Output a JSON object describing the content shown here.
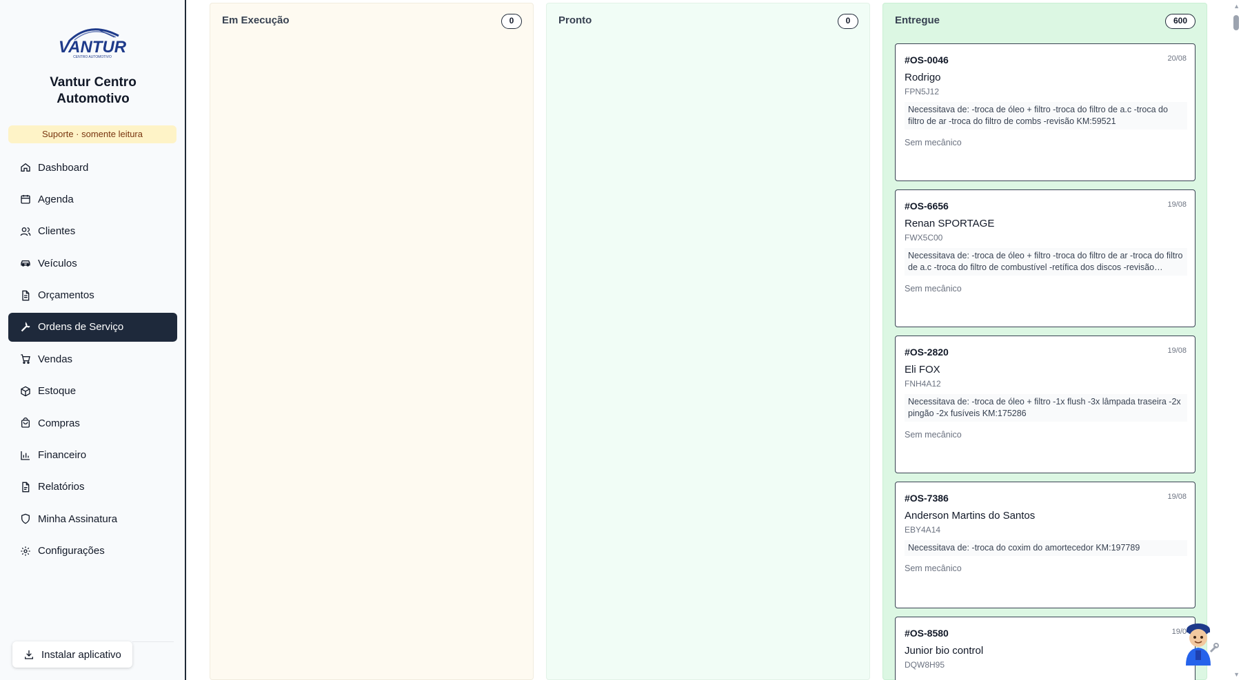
{
  "sidebar": {
    "company_name": "Vantur Centro Automotivo",
    "support_badge": "Suporte · somente leitura",
    "nav_items": [
      {
        "label": "Dashboard",
        "icon": "home-icon"
      },
      {
        "label": "Agenda",
        "icon": "calendar-icon"
      },
      {
        "label": "Clientes",
        "icon": "users-icon"
      },
      {
        "label": "Veículos",
        "icon": "car-icon"
      },
      {
        "label": "Orçamentos",
        "icon": "file-text-icon"
      },
      {
        "label": "Ordens de Serviço",
        "icon": "wrench-icon",
        "active": true
      },
      {
        "label": "Vendas",
        "icon": "cart-icon"
      },
      {
        "label": "Estoque",
        "icon": "package-icon"
      },
      {
        "label": "Compras",
        "icon": "shopping-bag-icon"
      },
      {
        "label": "Financeiro",
        "icon": "bar-chart-icon"
      },
      {
        "label": "Relatórios",
        "icon": "report-icon"
      },
      {
        "label": "Minha Assinatura",
        "icon": "shield-icon"
      },
      {
        "label": "Configurações",
        "icon": "gear-icon"
      }
    ],
    "install_label": "Instalar aplicativo"
  },
  "board": {
    "columns": [
      {
        "title": "Em Execução",
        "count": "0"
      },
      {
        "title": "Pronto",
        "count": "0"
      },
      {
        "title": "Entregue",
        "count": "600"
      }
    ],
    "cards": [
      {
        "id": "#OS-0046",
        "date": "20/08",
        "client": "Rodrigo",
        "plate": "FPN5J12",
        "description": "Necessitava de: -troca de óleo + filtro -troca do filtro de a.c -troca do filtro de ar -troca do filtro de combs -revisão KM:59521",
        "mechanic": "Sem mecânico"
      },
      {
        "id": "#OS-6656",
        "date": "19/08",
        "client": "Renan SPORTAGE",
        "plate": "FWX5C00",
        "description": "Necessitava de: -troca de óleo + filtro -troca do filtro de ar -troca do filtro de a.c -troca do filtro de combustível -retífica dos discos -revisão…",
        "mechanic": "Sem mecânico"
      },
      {
        "id": "#OS-2820",
        "date": "19/08",
        "client": "Eli FOX",
        "plate": "FNH4A12",
        "description": "Necessitava de: -troca de óleo + filtro -1x flush -3x lâmpada traseira -2x pingão -2x fusíveis KM:175286",
        "mechanic": "Sem mecânico"
      },
      {
        "id": "#OS-7386",
        "date": "19/08",
        "client": "Anderson Martins do Santos",
        "plate": "EBY4A14",
        "description": "Necessitava de: -troca do coxim do amortecedor KM:197789",
        "mechanic": "Sem mecânico"
      },
      {
        "id": "#OS-8580",
        "date": "19/0",
        "client": "Junior bio control",
        "plate": "DQW8H95",
        "description": "",
        "mechanic": ""
      }
    ]
  },
  "colors": {
    "sidebar_active": "#1e293b",
    "support_badge": "#fef3c7",
    "col_execucao": "#fefaf1",
    "col_pronto": "#f1fdf6",
    "col_entregue": "#dcf7e3"
  }
}
